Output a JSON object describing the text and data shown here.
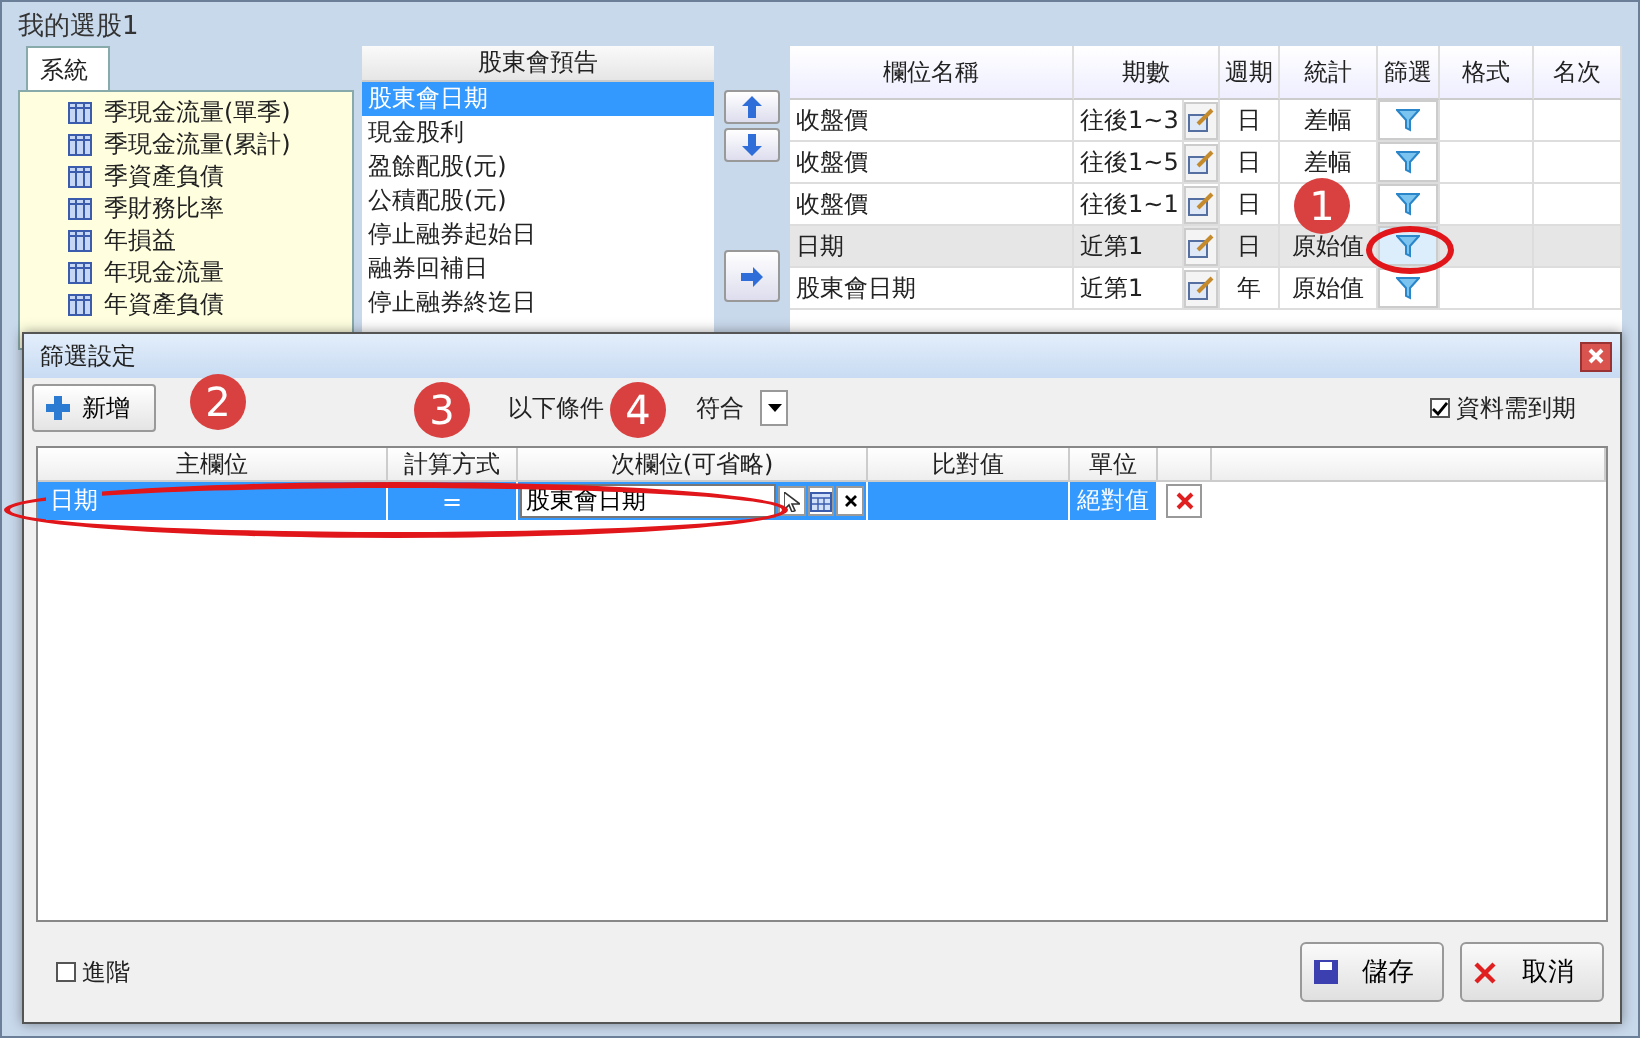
{
  "window": {
    "title": "我的選股1"
  },
  "tabs": [
    {
      "label": "系統",
      "selected": true
    }
  ],
  "tree_items": [
    "季現金流量(單季)",
    "季現金流量(累計)",
    "季資產負債",
    "季財務比率",
    "年損益",
    "年現金流量",
    "年資產負債"
  ],
  "field_list": {
    "title": "股東會預告",
    "items": [
      {
        "label": "股東會日期",
        "selected": true
      },
      {
        "label": "現金股利",
        "selected": false
      },
      {
        "label": "盈餘配股(元)",
        "selected": false
      },
      {
        "label": "公積配股(元)",
        "selected": false
      },
      {
        "label": "停止融券起始日",
        "selected": false
      },
      {
        "label": "融券回補日",
        "selected": false
      },
      {
        "label": "停止融券終迄日",
        "selected": false
      }
    ]
  },
  "columns_table": {
    "columns": [
      "欄位名稱",
      "期數",
      "週期",
      "統計",
      "篩選",
      "格式",
      "名次"
    ],
    "rows": [
      {
        "name": "收盤價",
        "periods": "往後1~3",
        "cycle": "日",
        "stat": "差幅",
        "selected": false
      },
      {
        "name": "收盤價",
        "periods": "往後1~5",
        "cycle": "日",
        "stat": "差幅",
        "selected": false
      },
      {
        "name": "收盤價",
        "periods": "往後1~1",
        "cycle": "日",
        "selected": false
      },
      {
        "name": "日期",
        "periods": "近第1",
        "cycle": "日",
        "stat": "原始值",
        "selected": true
      },
      {
        "name": "股東會日期",
        "periods": "近第1",
        "cycle": "年",
        "stat": "原始值",
        "selected": false
      }
    ]
  },
  "dialog": {
    "title": "篩選設定",
    "add_button": "新增",
    "condition_prefix": "以下條件",
    "condition_suffix": "符合",
    "require_expiry": {
      "label": "資料需到期",
      "checked": true
    },
    "columns": [
      "主欄位",
      "計算方式",
      "次欄位(可省略)",
      "比對值",
      "單位"
    ],
    "rows": [
      {
        "main": "日期",
        "op": "=",
        "secondary": "股東會日期",
        "unit": "絕對值",
        "selected": true
      }
    ],
    "advanced": {
      "label": "進階",
      "checked": false
    },
    "save_button": "儲存",
    "cancel_button": "取消"
  },
  "badges": [
    "1",
    "2",
    "3",
    "4"
  ]
}
